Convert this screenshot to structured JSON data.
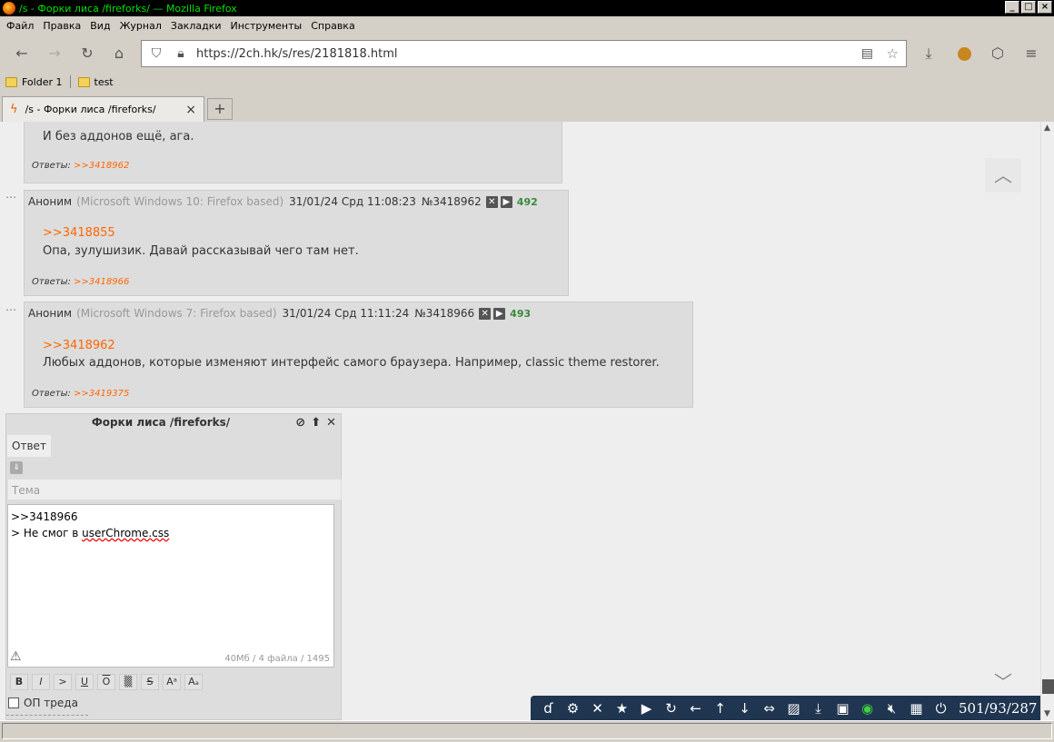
{
  "window": {
    "title": "/s - Форки лиса /fireforks/ — Mozilla Firefox",
    "minimize": "_",
    "maximize": "□",
    "close": "×"
  },
  "menu": [
    "Файл",
    "Правка",
    "Вид",
    "Журнал",
    "Закладки",
    "Инструменты",
    "Справка"
  ],
  "nav": {
    "url": "https://2ch.hk/s/res/2181818.html"
  },
  "bookmarks": [
    {
      "label": "Folder 1"
    },
    {
      "label": "test"
    }
  ],
  "tab": {
    "title": "/s - Форки лиса /fireforks/",
    "new_tab": "+"
  },
  "posts": [
    {
      "text": "И без аддонов ещё, ага.",
      "replies_label": "Ответы:",
      "replies": ">>3418962"
    },
    {
      "author": "Аноним",
      "os": "(Microsoft Windows 10: Firefox based)",
      "date": "31/01/24 Срд 11:08:23",
      "number": "№3418962",
      "count": "492",
      "quote_link": ">>3418855",
      "text": "Опа, зулушизик. Давай рассказывай чего там нет.",
      "replies_label": "Ответы:",
      "replies": ">>3418966"
    },
    {
      "author": "Аноним",
      "os": "(Microsoft Windows 7: Firefox based)",
      "date": "31/01/24 Срд 11:11:24",
      "number": "№3418966",
      "count": "493",
      "quote_link": ">>3418962",
      "text": "Любых аддонов, которые изменяют интерфейс самого браузера. Например, classic theme restorer.",
      "replies_label": "Ответы:",
      "replies": ">>3419375"
    }
  ],
  "reply_form": {
    "title": "Форки лиса /fireforks/",
    "tab_label": "Ответ",
    "subject_placeholder": "Тема",
    "text_line1": ">>3418966",
    "text_line2_prefix": "> Не смог в ",
    "text_line2_misspelled": "userChrome.css",
    "info": "40Мб / 4 файла / 1495",
    "toolbar": [
      "B",
      "I",
      ">",
      "U",
      "O",
      "▒",
      "S",
      "Aᵃ",
      "Aₐ"
    ],
    "op_label": "ОП треда"
  },
  "bottom_toolbar": {
    "stats": "501/93/287"
  }
}
